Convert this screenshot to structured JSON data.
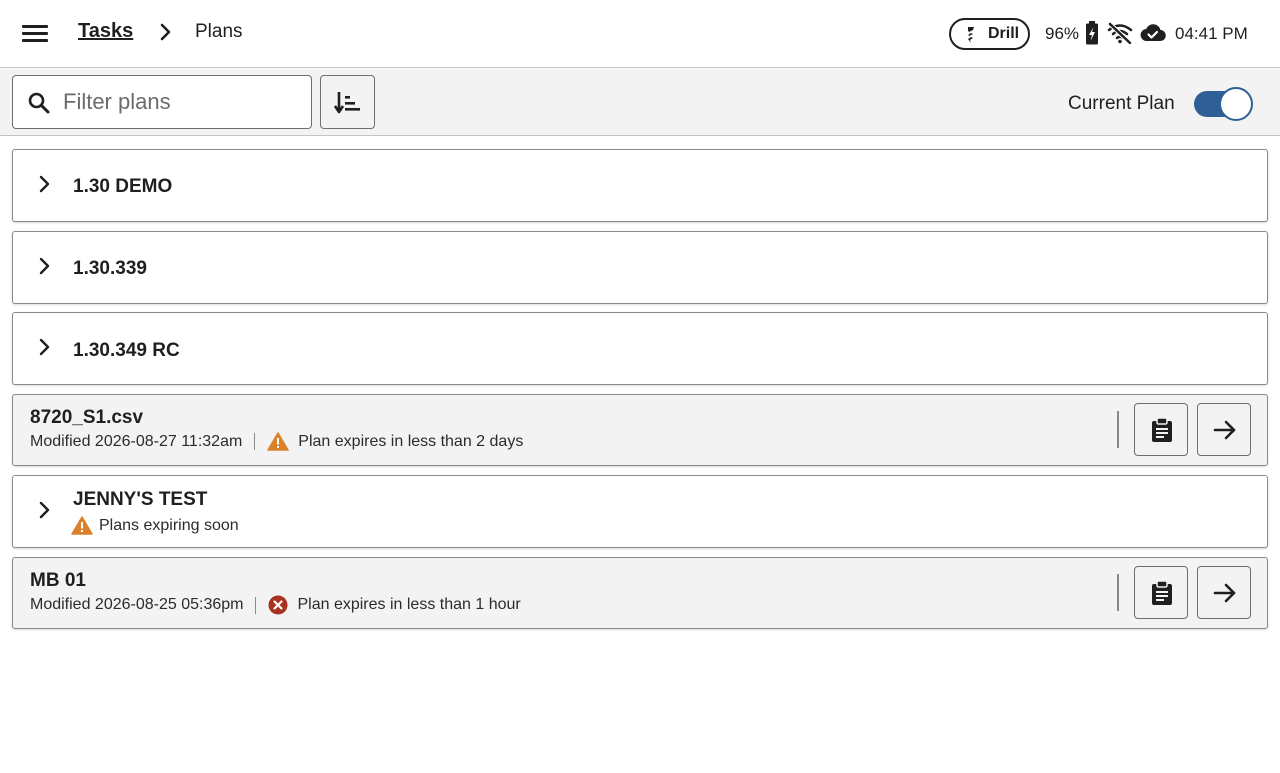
{
  "header": {
    "breadcrumb_parent": "Tasks",
    "breadcrumb_current": "Plans",
    "mode_badge": "Drill",
    "battery": "96%",
    "time": "04:41 PM"
  },
  "toolbar": {
    "filter_placeholder": "Filter plans",
    "filter_value": "",
    "toggle_label": "Current Plan",
    "toggle_on": true
  },
  "colors": {
    "accent": "#2f5f96",
    "warning": "#d9822b",
    "error": "#a8321f",
    "card_file_bg": "#f3f3f3"
  },
  "plans": [
    {
      "kind": "folder",
      "title": "1.30 DEMO"
    },
    {
      "kind": "folder",
      "title": "1.30.339"
    },
    {
      "kind": "folder",
      "title": "1.30.349 RC"
    },
    {
      "kind": "file",
      "title": "8720_S1.csv",
      "modified": "Modified 2026-08-27 11:32am",
      "status": "Plan expires in less than 2 days",
      "status_icon": "warning-triangle-icon"
    },
    {
      "kind": "folder",
      "title": "JENNY'S TEST",
      "status": "Plans expiring soon",
      "status_icon": "warning-triangle-icon"
    },
    {
      "kind": "file",
      "title": "MB 01",
      "modified": "Modified 2026-08-25 05:36pm",
      "status": "Plan expires in less than 1 hour",
      "status_icon": "error-circle-icon"
    }
  ]
}
